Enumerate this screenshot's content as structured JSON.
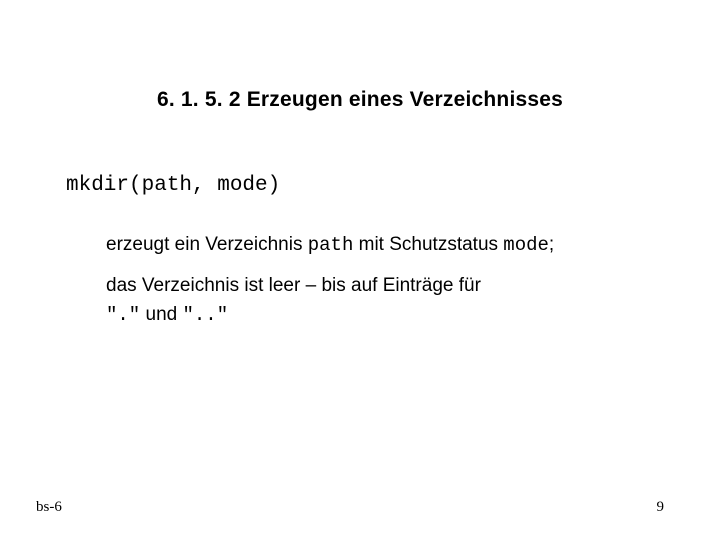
{
  "title": "6. 1. 5. 2  Erzeugen eines Verzeichnisses",
  "code": "mkdir(path, mode)",
  "body1": {
    "t1": "erzeugt ein Verzeichnis ",
    "c1": "path",
    "t2": "  mit Schutzstatus ",
    "c2": "mode",
    "t3": ";"
  },
  "body2": {
    "line1": "das Verzeichnis ist leer – bis auf Einträge für",
    "q1": "\".\"",
    "mid": "  und  ",
    "q2": "\"..\""
  },
  "footer": {
    "left": "bs-6",
    "right": "9"
  }
}
